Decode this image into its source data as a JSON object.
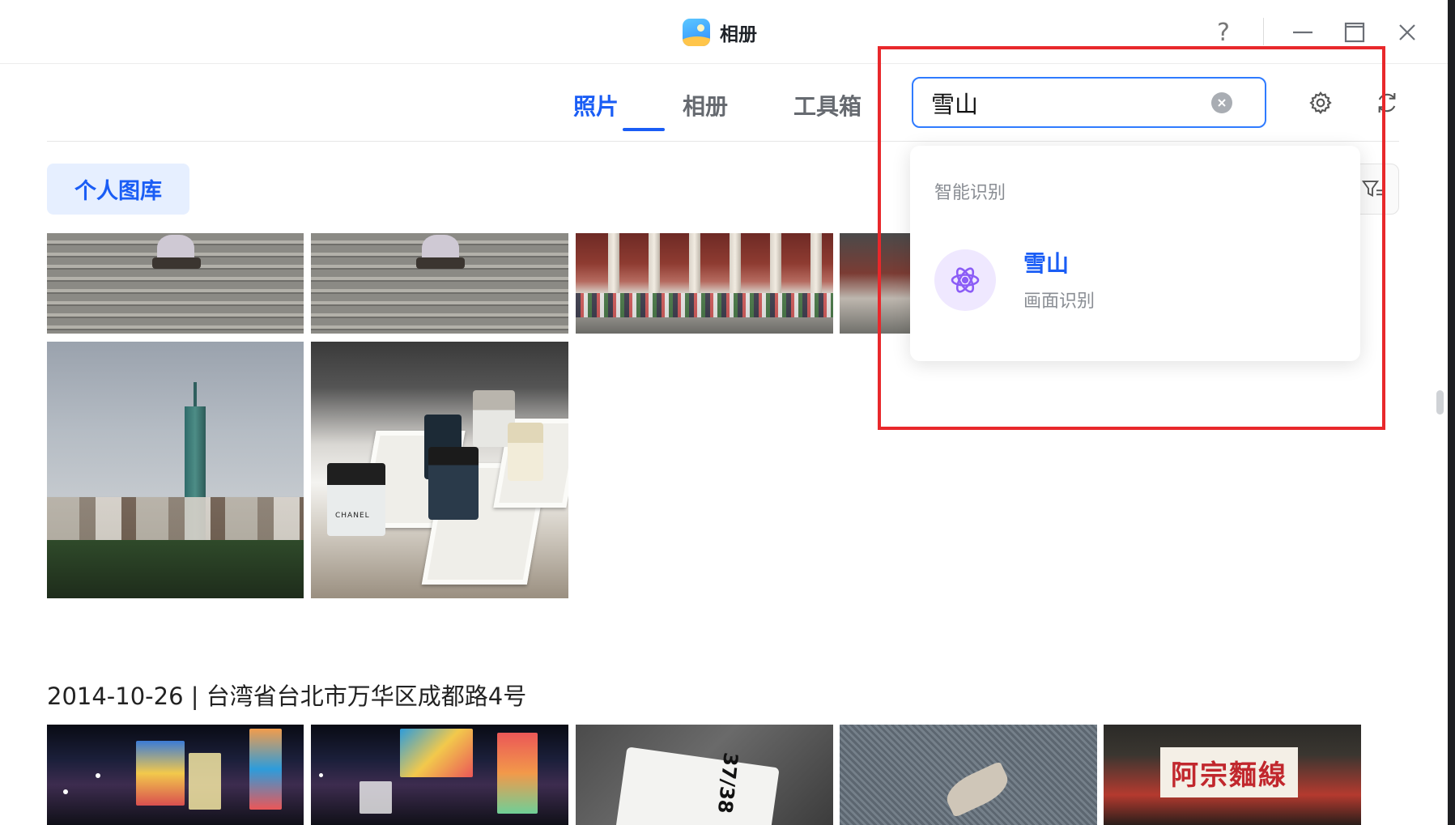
{
  "window": {
    "title": "相册",
    "help_label": "?"
  },
  "nav": {
    "tabs": [
      {
        "label": "照片",
        "active": true
      },
      {
        "label": "相册",
        "active": false
      },
      {
        "label": "工具箱",
        "active": false
      }
    ]
  },
  "search": {
    "value": "雪山",
    "placeholder": ""
  },
  "library": {
    "chip_label": "个人图库"
  },
  "dropdown": {
    "section_title": "智能识别",
    "items": [
      {
        "title": "雪山",
        "subtitle": "画面识别",
        "icon": "atom-icon"
      }
    ]
  },
  "groups": [
    {
      "heading": "2014-10-26 | 台湾省台北市万华区成都路4号"
    }
  ],
  "photo_texts": {
    "tag_code": "37/38",
    "shop_sign": "阿宗麵線",
    "perfume_brand": "CHANEL"
  },
  "colors": {
    "accent": "#1a5df5",
    "highlight": "#e8282b",
    "chip_bg": "#e6efff",
    "dropdown_icon_bg": "#efe8ff",
    "dropdown_icon": "#8b5cf6"
  }
}
